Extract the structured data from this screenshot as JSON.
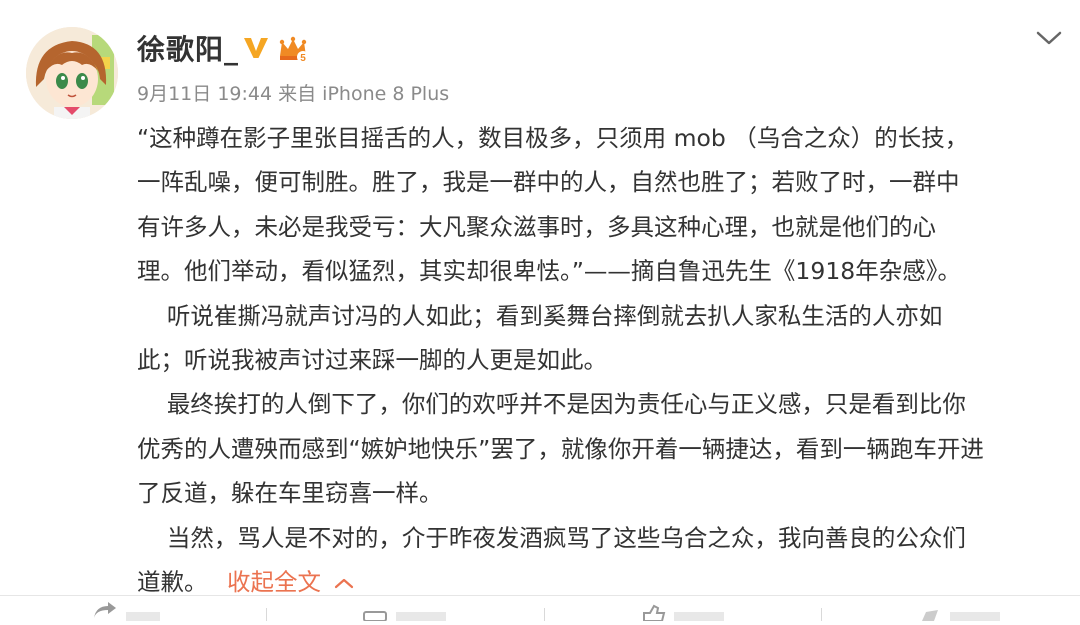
{
  "post": {
    "author": {
      "name": "徐歌阳_",
      "avatar_icon": "anime-girl-avatar-icon",
      "verified_icon": "verified-v-icon",
      "level_icon": "crown-level-icon"
    },
    "meta": {
      "date": "9月11日",
      "time": "19:44",
      "source": "来自 iPhone 8 Plus"
    },
    "menu_icon": "chevron-down-icon",
    "body_lines": [
      "“这种蹲在影子里张目摇舌的人，数目极多，只须用 mob （乌合之众）的长技，",
      "一阵乱噪，便可制胜。胜了，我是一群中的人，自然也胜了；若败了时，一群中",
      "有许多人，未必是我受亏：大凡聚众滋事时，多具这种心理，也就是他们的心",
      "理。他们举动，看似猛烈，其实却很卑怯。”——摘自鲁迅先生《1918年杂感》。",
      "    听说崔撕冯就声讨冯的人如此；看到奚舞台摔倒就去扒人家私生活的人亦如",
      "此；听说我被声讨过来踩一脚的人更是如此。",
      "    最终挨打的人倒下了，你们的欢呼并不是因为责任心与正义感，只是看到比你",
      "优秀的人遭殃而感到“嫉妒地快乐”罢了，就像你开着一辆捷达，看到一辆跑车开进",
      "了反道，躲在车里窃喜一样。",
      "    当然，骂人是不对的，介于昨夜发酒疯骂了这些乌合之众，我向善良的公众们",
      "道歉。"
    ],
    "collapse_label": "收起全文",
    "collapse_icon": "chevron-up-icon"
  },
  "colors": {
    "text": "#333333",
    "meta": "#8a8a8a",
    "link": "#eb7350",
    "verified": "#f5a623"
  }
}
